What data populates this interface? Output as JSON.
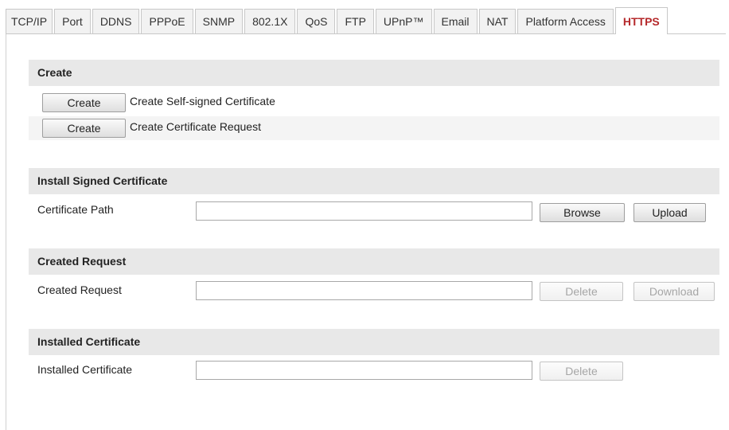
{
  "tabs": [
    "TCP/IP",
    "Port",
    "DDNS",
    "PPPoE",
    "SNMP",
    "802.1X",
    "QoS",
    "FTP",
    "UPnP™",
    "Email",
    "NAT",
    "Platform Access",
    "HTTPS"
  ],
  "active_tab": "HTTPS",
  "create": {
    "title": "Create",
    "self_signed": {
      "button": "Create",
      "label": "Create Self-signed Certificate"
    },
    "request": {
      "button": "Create",
      "label": "Create Certificate Request"
    }
  },
  "install": {
    "title": "Install Signed Certificate",
    "path_label": "Certificate Path",
    "path_value": "",
    "browse_button": "Browse",
    "upload_button": "Upload"
  },
  "created_request": {
    "title": "Created Request",
    "label": "Created Request",
    "value": "",
    "delete_button": "Delete",
    "download_button": "Download"
  },
  "installed": {
    "title": "Installed Certificate",
    "label": "Installed Certificate",
    "value": "",
    "delete_button": "Delete"
  },
  "colors": {
    "active_tab_text": "#b5292b",
    "section_header_bg": "#e8e8e8",
    "disabled_text": "#a6a6a6"
  }
}
